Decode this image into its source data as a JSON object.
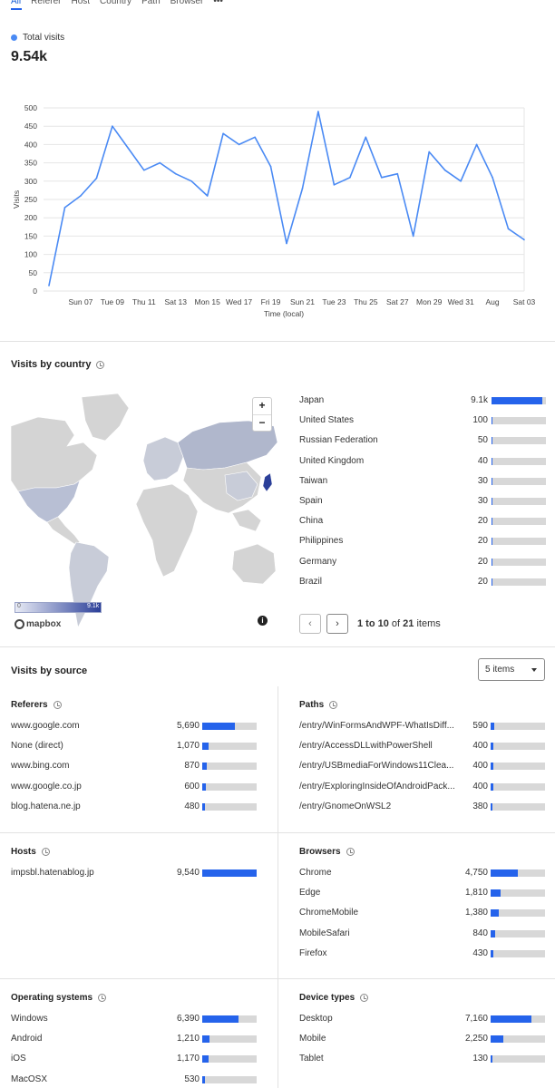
{
  "tabs": [
    "All",
    "Referer",
    "Host",
    "Country",
    "Path",
    "Browser"
  ],
  "more_label": "•••",
  "legend_label": "Total visits",
  "total": "9.54k",
  "colors": {
    "accent": "#2563eb",
    "line": "#4a8af4",
    "bar_bg": "#d8d8d8",
    "map_land": "#d4d4d4",
    "map_low": "#c2c8d8",
    "map_high": "#2b3f99"
  },
  "chart_data": {
    "type": "line",
    "title": "",
    "xlabel": "Time (local)",
    "ylabel": "Visits",
    "ylim": [
      0,
      500
    ],
    "yticks": [
      0,
      50,
      100,
      150,
      200,
      250,
      300,
      350,
      400,
      450,
      500
    ],
    "xtick_labels": [
      "Sun 07",
      "Tue 09",
      "Thu 11",
      "Sat 13",
      "Mon 15",
      "Wed 17",
      "Fri 19",
      "Sun 21",
      "Tue 23",
      "Thu 25",
      "Sat 27",
      "Mon 29",
      "Wed 31",
      "Aug",
      "Sat 03"
    ],
    "x": [
      "Jul 05",
      "Jul 06",
      "Jul 07",
      "Jul 08",
      "Jul 09",
      "Jul 10",
      "Jul 11",
      "Jul 12",
      "Jul 13",
      "Jul 14",
      "Jul 15",
      "Jul 16",
      "Jul 17",
      "Jul 18",
      "Jul 19",
      "Jul 20",
      "Jul 21",
      "Jul 22",
      "Jul 23",
      "Jul 24",
      "Jul 25",
      "Jul 26",
      "Jul 27",
      "Jul 28",
      "Jul 29",
      "Jul 30",
      "Jul 31",
      "Aug 01",
      "Aug 02",
      "Aug 03",
      "Aug 04"
    ],
    "series": [
      {
        "values": [
          15,
          228,
          260,
          308,
          450,
          390,
          330,
          350,
          320,
          300,
          260,
          430,
          400,
          420,
          340,
          130,
          280,
          490,
          290,
          310,
          420,
          310,
          320,
          150,
          380,
          330,
          300,
          400,
          310,
          170,
          140
        ]
      }
    ],
    "grid": true
  },
  "country_section": {
    "title": "Visits by country",
    "zoom_in": "+",
    "zoom_out": "−",
    "legend_min": "0",
    "legend_max": "9.1k",
    "attribution": "mapbox",
    "info": "i",
    "max_value": 9100,
    "rows": [
      {
        "name": "Japan",
        "value": "9.1k",
        "n": 9100
      },
      {
        "name": "United States",
        "value": "100",
        "n": 100
      },
      {
        "name": "Russian Federation",
        "value": "50",
        "n": 50
      },
      {
        "name": "United Kingdom",
        "value": "40",
        "n": 40
      },
      {
        "name": "Taiwan",
        "value": "30",
        "n": 30
      },
      {
        "name": "Spain",
        "value": "30",
        "n": 30
      },
      {
        "name": "China",
        "value": "20",
        "n": 20
      },
      {
        "name": "Philippines",
        "value": "20",
        "n": 20
      },
      {
        "name": "Germany",
        "value": "20",
        "n": 20
      },
      {
        "name": "Brazil",
        "value": "20",
        "n": 20
      }
    ],
    "pager": {
      "prev": "‹",
      "next": "›",
      "range": "1 to 10",
      "of": "of",
      "total": "21",
      "items": "items"
    }
  },
  "source_section": {
    "title": "Visits by source",
    "dropdown": "5 items",
    "panels": {
      "referers": {
        "title": "Referers",
        "max": 9540,
        "rows": [
          {
            "name": "www.google.com",
            "value": "5,690",
            "n": 5690
          },
          {
            "name": "None (direct)",
            "value": "1,070",
            "n": 1070
          },
          {
            "name": "www.bing.com",
            "value": "870",
            "n": 870
          },
          {
            "name": "www.google.co.jp",
            "value": "600",
            "n": 600
          },
          {
            "name": "blog.hatena.ne.jp",
            "value": "480",
            "n": 480
          }
        ]
      },
      "paths": {
        "title": "Paths",
        "max": 9540,
        "rows": [
          {
            "name": "/entry/WinFormsAndWPF-WhatIsDiff...",
            "value": "590",
            "n": 590
          },
          {
            "name": "/entry/AccessDLLwithPowerShell",
            "value": "400",
            "n": 400
          },
          {
            "name": "/entry/USBmediaForWindows11Clea...",
            "value": "400",
            "n": 400
          },
          {
            "name": "/entry/ExploringInsideOfAndroidPack...",
            "value": "400",
            "n": 400
          },
          {
            "name": "/entry/GnomeOnWSL2",
            "value": "380",
            "n": 380
          }
        ]
      },
      "hosts": {
        "title": "Hosts",
        "max": 9540,
        "rows": [
          {
            "name": "impsbl.hatenablog.jp",
            "value": "9,540",
            "n": 9540
          }
        ]
      },
      "browsers": {
        "title": "Browsers",
        "max": 9540,
        "rows": [
          {
            "name": "Chrome",
            "value": "4,750",
            "n": 4750
          },
          {
            "name": "Edge",
            "value": "1,810",
            "n": 1810
          },
          {
            "name": "ChromeMobile",
            "value": "1,380",
            "n": 1380
          },
          {
            "name": "MobileSafari",
            "value": "840",
            "n": 840
          },
          {
            "name": "Firefox",
            "value": "430",
            "n": 430
          }
        ]
      },
      "os": {
        "title": "Operating systems",
        "max": 9540,
        "rows": [
          {
            "name": "Windows",
            "value": "6,390",
            "n": 6390
          },
          {
            "name": "Android",
            "value": "1,210",
            "n": 1210
          },
          {
            "name": "iOS",
            "value": "1,170",
            "n": 1170
          },
          {
            "name": "MacOSX",
            "value": "530",
            "n": 530
          }
        ]
      },
      "devices": {
        "title": "Device types",
        "max": 9540,
        "rows": [
          {
            "name": "Desktop",
            "value": "7,160",
            "n": 7160
          },
          {
            "name": "Mobile",
            "value": "2,250",
            "n": 2250
          },
          {
            "name": "Tablet",
            "value": "130",
            "n": 130
          }
        ]
      }
    }
  }
}
